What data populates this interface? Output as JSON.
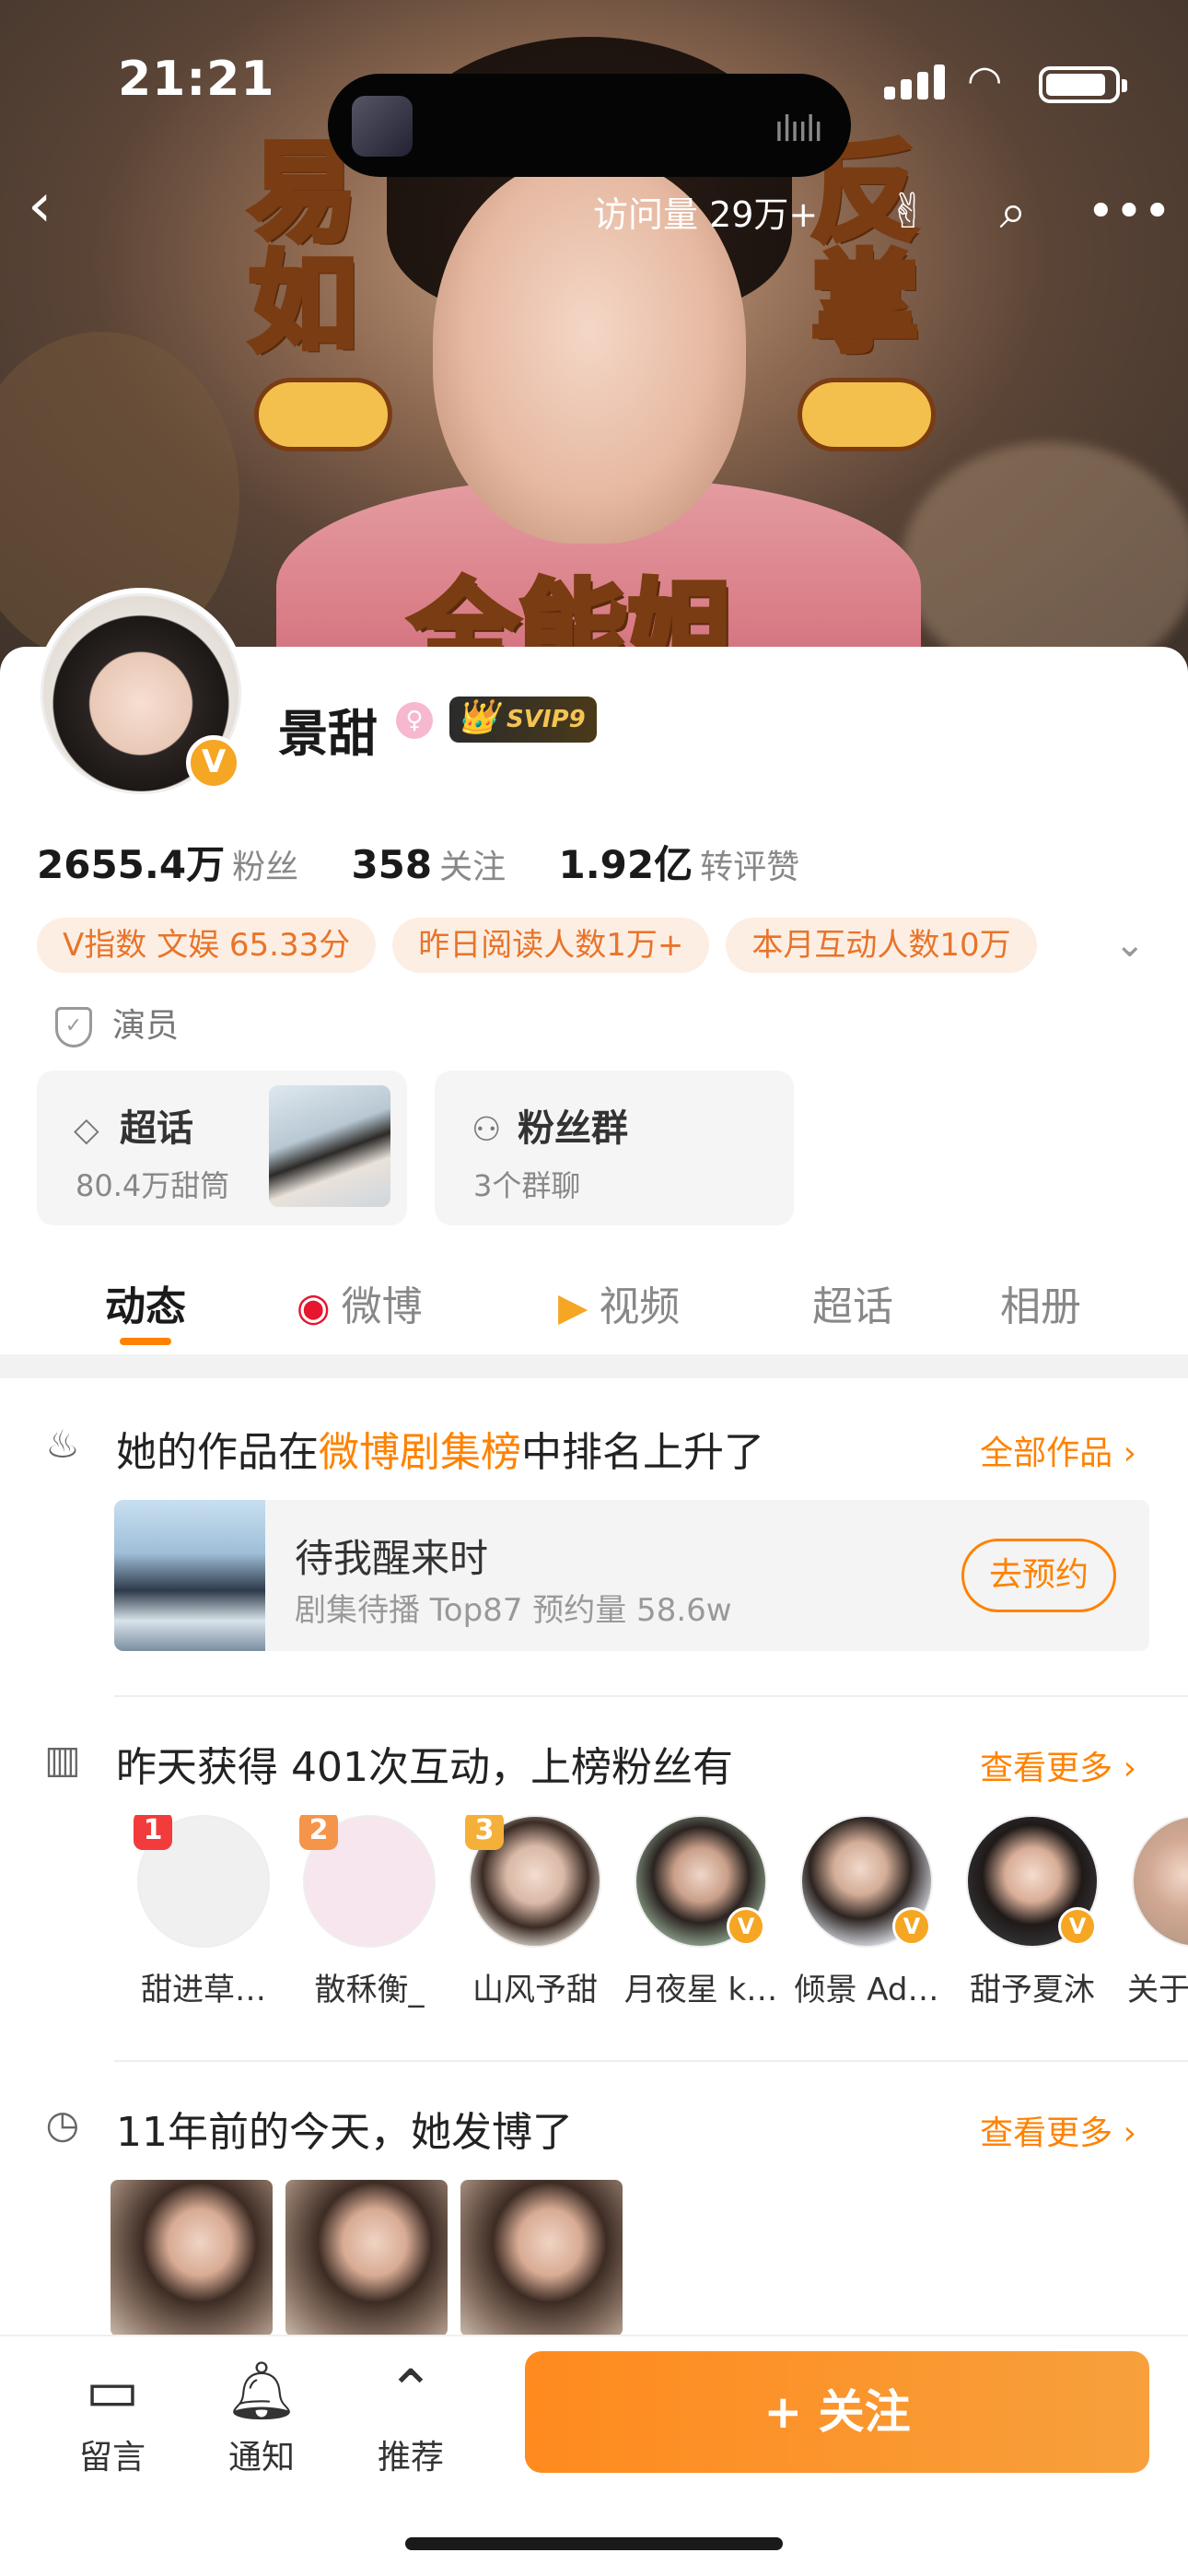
{
  "status_bar": {
    "time": "21:21"
  },
  "header": {
    "visits": "访问量 29万+"
  },
  "banner": {
    "chars_left": [
      "易",
      "如"
    ],
    "chars_right": [
      "反",
      "掌"
    ],
    "title": "全能姐"
  },
  "profile": {
    "name": "景甜",
    "vip_label": "SVIP9",
    "stats": [
      {
        "value": "2655.4万",
        "label": "粉丝"
      },
      {
        "value": "358",
        "label": "关注"
      },
      {
        "value": "1.92亿",
        "label": "转评赞"
      }
    ],
    "tags": [
      "V指数 文娱 65.33分",
      "昨日阅读人数1万+",
      "本月互动人数10万"
    ],
    "identity": "演员",
    "supertopic": {
      "title": "超话",
      "sub": "80.4万甜筒"
    },
    "fangroup": {
      "title": "粉丝群",
      "sub": "3个群聊"
    }
  },
  "tabs": [
    {
      "label": "动态",
      "icon": ""
    },
    {
      "label": "微博",
      "icon": "weibo-icon"
    },
    {
      "label": "视频",
      "icon": "video-icon"
    },
    {
      "label": "超话",
      "icon": ""
    },
    {
      "label": "相册",
      "icon": ""
    }
  ],
  "feed": {
    "rank": {
      "title_pre": "她的作品在",
      "title_hl": "微博剧集榜",
      "title_post": "中排名上升了",
      "more": "全部作品 ›",
      "drama_title": "待我醒来时",
      "drama_sub": "剧集待播 Top87 预约量 58.6w",
      "button": "去预约"
    },
    "interaction": {
      "title": "昨天获得 401次互动，上榜粉丝有",
      "more": "查看更多 ›",
      "fans": [
        {
          "rank": "1",
          "name": "甜进草…",
          "verified": false
        },
        {
          "rank": "2",
          "name": "散秝衡_",
          "verified": false
        },
        {
          "rank": "3",
          "name": "山风予甜",
          "verified": false
        },
        {
          "rank": "",
          "name": "月夜星 k…",
          "verified": true
        },
        {
          "rank": "",
          "name": "倾景 Ad…",
          "verified": true
        },
        {
          "rank": "",
          "name": "甜予夏沐",
          "verified": true
        },
        {
          "rank": "",
          "name": "关于甜",
          "verified": false
        }
      ]
    },
    "memory": {
      "title": "11年前的今天，她发博了",
      "more": "查看更多 ›"
    }
  },
  "bottom_bar": {
    "message": "留言",
    "notify": "通知",
    "recommend": "推荐",
    "follow": "+ 关注"
  },
  "colors": {
    "accent": "#ff8200",
    "tag_bg": "#fdeee3",
    "vip_gold": "#f6c453"
  }
}
